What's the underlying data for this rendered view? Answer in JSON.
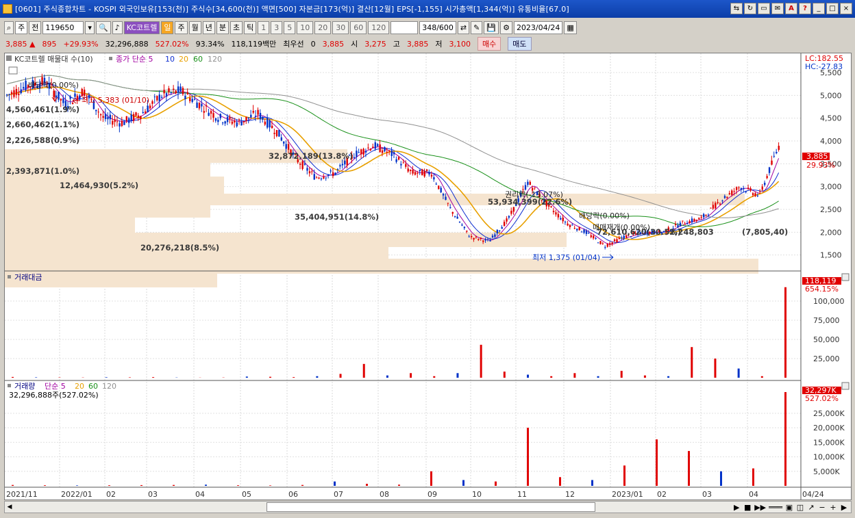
{
  "window": {
    "title": "[0601] 주식종합차트 - KOSPI 외국인보유[153(천)] 주식수[34,600(천)] 액면[500] 자본금[173(억)] 결산[12월] EPS[-1,155] 시가총액[1,344(억)] 유통비율[67.0]",
    "buttons": [
      "minimize",
      "maximize",
      "close"
    ]
  },
  "toolbar": {
    "market": "주",
    "prev": "전",
    "code": "119650",
    "indicator": "KC코트렐",
    "periods": [
      "일",
      "주",
      "월",
      "년",
      "분",
      "초",
      "틱"
    ],
    "intervals": [
      "1",
      "3",
      "5",
      "10",
      "20",
      "30",
      "60",
      "120"
    ],
    "count": "348",
    "count_total": "/600",
    "date": "2023/04/24"
  },
  "quote": {
    "price": "3,885",
    "change": "895",
    "change_pct": "+29.93%",
    "volume": "32,296,888",
    "vol_pct": "527.02%",
    "turnover": "93.34%",
    "amount": "118,119백만",
    "pref_label": "최우선",
    "pref_value": "0",
    "ask": "3,885",
    "open_label": "시",
    "open": "3,275",
    "high_label": "고",
    "high": "3,885",
    "low_label": "저",
    "low": "3,100",
    "buy": "매수",
    "sell": "매도"
  },
  "legend": {
    "main": "KC코트렐 매물대 수(10)",
    "ma_label": "종가 단순 5",
    "ma": [
      "10",
      "20",
      "60",
      "120"
    ],
    "amount_pane": "거래대금",
    "volume_pane": "거래량",
    "vol_ma": "단순 5",
    "vol_ma_values": [
      "20",
      "60",
      "120"
    ],
    "volume_value": "32,296,888주(527.02%)"
  },
  "right_axis": {
    "lc": "LC:182.55",
    "hc": "HC:-27.83",
    "price_ticks": [
      "5,500",
      "5,000",
      "4,500",
      "4,000",
      "3,500",
      "3,000",
      "2,500",
      "2,000",
      "1,500"
    ],
    "price_current": "3,885",
    "price_pct": "29.93%",
    "amount_ticks": [
      "100,000",
      "75,000",
      "50,000",
      "25,000"
    ],
    "amount_current": "118,119",
    "amount_pct": "654.15%",
    "volume_ticks": [
      "25,000K",
      "20,000K",
      "15,000K",
      "10,000K",
      "5,000K"
    ],
    "volume_current": "32,297K",
    "volume_pct": "527.02%"
  },
  "x_axis": [
    "2021/11",
    "2022/01",
    "02",
    "03",
    "04",
    "05",
    "06",
    "07",
    "08",
    "09",
    "10",
    "11",
    "12",
    "2023/01",
    "02",
    "03",
    "04",
    "04/24"
  ],
  "volume_profile": [
    "4,560,461(1.9%)",
    "2,660,462(1.1%)",
    "2,226,588(0.9%)",
    "32,872,189(13.8%)",
    "2,393,871(1.0%)",
    "12,464,930(5.2%)",
    "53,934,399(22.6%)",
    "35,404,951(14.8%)",
    "72,610,620(30.5%)",
    "2,248,803",
    "(7,805,40)",
    "20,276,218(8.5%)"
  ],
  "annotations": {
    "dividend1": "배당락(0.00%)",
    "high": "최고 5,383 (01/10)",
    "rights": "권리락(-13.07%)",
    "dividend2": "배당락(0.00%)",
    "resume": "매매재개(0.00%)",
    "low": "최저 1,375 (01/04)"
  },
  "colors": {
    "up": "#e00000",
    "down": "#0032c8",
    "ma5": "#a000a0",
    "ma10": "#1030d0",
    "ma20": "#e8a000",
    "ma60": "#189018",
    "ma120": "#909090",
    "profile": "#f5e4cf"
  },
  "chart_data": {
    "type": "candlestick",
    "price_range": [
      1300,
      5800
    ],
    "daily_close_series": [
      5000,
      5200,
      5300,
      4800,
      5100,
      4500,
      4400,
      4600,
      5000,
      5100,
      4800,
      4500,
      4400,
      4600,
      4200,
      3600,
      3200,
      3300,
      3700,
      3900,
      3700,
      3300,
      3300,
      2500,
      1900,
      1800,
      2300,
      3100,
      2600,
      2200,
      2000,
      1700,
      1900,
      2000,
      2000,
      2200,
      2300,
      2700,
      3000,
      2800,
      3885
    ],
    "trading_amount_bars_million": [
      1000,
      500,
      400,
      300,
      600,
      500,
      800,
      300,
      200,
      300,
      1500,
      1200,
      800,
      2000,
      5000,
      18000,
      3000,
      6000,
      2000,
      6000,
      43000,
      8000,
      4000,
      2000,
      6000,
      2000,
      9000,
      3000,
      2000,
      40000,
      25000,
      12000,
      2000,
      118119
    ],
    "volume_bars_k": [
      300,
      200,
      150,
      200,
      250,
      300,
      400,
      200,
      150,
      300,
      1500,
      700,
      400,
      5000,
      2000,
      1500,
      20000,
      3000,
      2000,
      7000,
      16000,
      12000,
      5000,
      6000,
      32297
    ]
  }
}
